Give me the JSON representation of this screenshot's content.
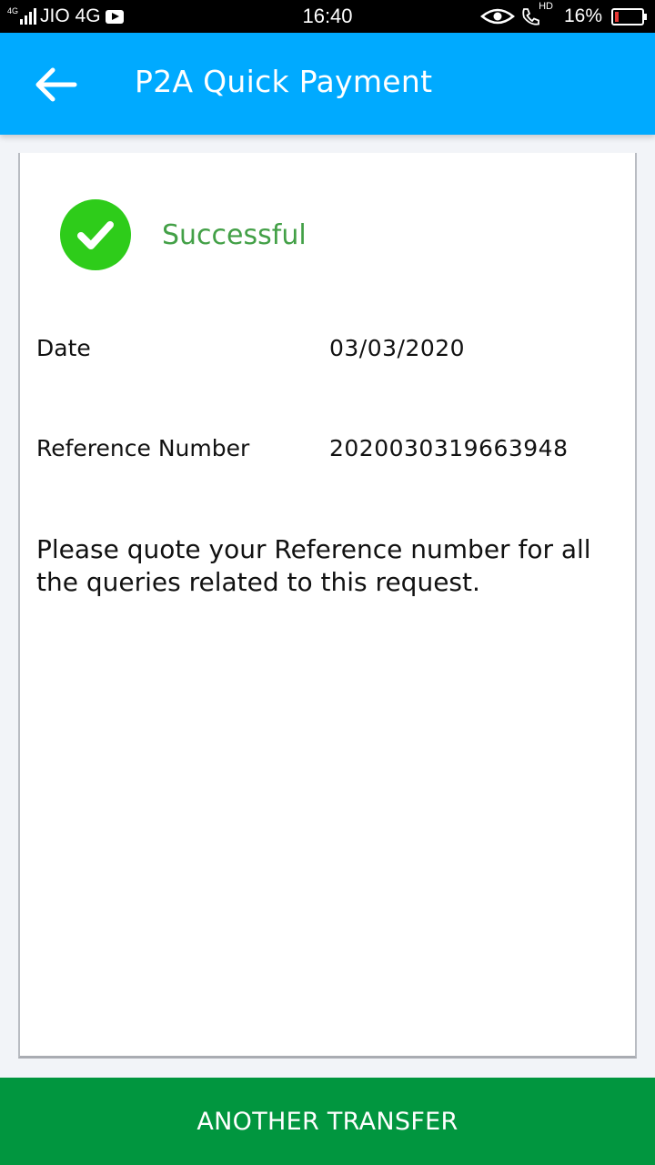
{
  "status_bar": {
    "network_type": "4G",
    "carrier": "JIO 4G",
    "time": "16:40",
    "hd_label": "HD",
    "battery_percent": "16%",
    "battery_level": 0.16
  },
  "app_bar": {
    "back_icon": "back-arrow-icon",
    "title": "P2A Quick Payment",
    "background_color": "#00aaff"
  },
  "result": {
    "status_icon": "check-circle-icon",
    "status_label": "Successful",
    "status_color": "#43a047"
  },
  "details": [
    {
      "label": "Date",
      "value": "03/03/2020"
    },
    {
      "label": "Reference Number",
      "value": "2020030319663948"
    }
  ],
  "note": "Please quote your Reference number for all the queries related to this request.",
  "footer": {
    "button_label": "ANOTHER TRANSFER",
    "button_color": "#01963f"
  }
}
